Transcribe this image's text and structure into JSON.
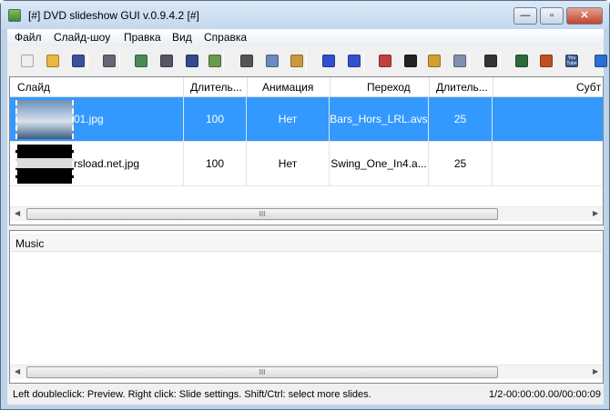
{
  "window": {
    "title": "[#] DVD slideshow GUI v.0.9.4.2 [#]",
    "minimize": "—",
    "maximize": "▫",
    "close": "✕"
  },
  "menu": [
    "Файл",
    "Слайд-шоу",
    "Правка",
    "Вид",
    "Справка"
  ],
  "toolbar": {
    "icons": [
      "new-icon",
      "open-icon",
      "save-icon",
      "settings-tools-icon",
      "add-slide-icon",
      "add-music-icon",
      "text-icon",
      "image-icon",
      "cut-icon",
      "copy-icon",
      "paste-icon",
      "move-up-icon",
      "move-down-icon",
      "crop-image-icon",
      "clapperboard-icon",
      "brush-icon",
      "burn-icon",
      "presentation-icon",
      "export-video-icon",
      "dvd-icon",
      "youtube-icon",
      "help-icon"
    ],
    "youtube_label": "You Tube"
  },
  "slides": {
    "columns": [
      "Слайд",
      "Длитель...",
      "Анимация",
      "Переход",
      "Длитель...",
      "Субт"
    ],
    "rows": [
      {
        "file": "01.jpg",
        "duration": "100",
        "animation": "Нет",
        "transition": "Bars_Hors_LRL.avs",
        "transition_duration": "25",
        "selected": true
      },
      {
        "file": "rsload.net.jpg",
        "duration": "100",
        "animation": "Нет",
        "transition": "Swing_One_In4.a...",
        "transition_duration": "25",
        "selected": false
      }
    ],
    "scroll_grip": "III"
  },
  "music": {
    "header": "Music",
    "scroll_grip": "III"
  },
  "status": {
    "hint": "Left doubleclick: Preview. Right click: Slide settings. Shift/Ctrl: select more slides.",
    "position": "1/2-00:00:00.00/00:00:09"
  },
  "colors": {
    "selection": "#3399ff"
  }
}
